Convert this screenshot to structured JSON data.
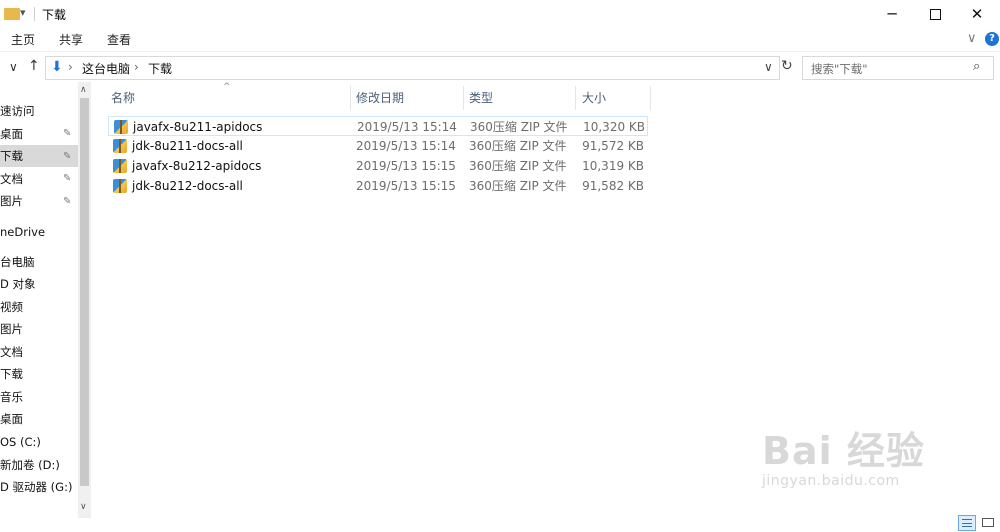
{
  "window": {
    "title": "下载"
  },
  "ribbon": {
    "tabs": [
      "主页",
      "共享",
      "查看"
    ]
  },
  "address": {
    "crumbs": [
      "这台电脑",
      "下载"
    ],
    "separator": "›"
  },
  "search": {
    "placeholder": "搜索\"下载\""
  },
  "nav": {
    "items": [
      {
        "label": "速访问",
        "pinned": false
      },
      {
        "label": "桌面",
        "pinned": true
      },
      {
        "label": "下载",
        "pinned": true,
        "selected": true
      },
      {
        "label": "文档",
        "pinned": true
      },
      {
        "label": "图片",
        "pinned": true
      },
      {
        "label": "neDrive",
        "pinned": false
      },
      {
        "label": "台电脑",
        "pinned": false
      },
      {
        "label": "D 对象",
        "pinned": false
      },
      {
        "label": "视频",
        "pinned": false
      },
      {
        "label": "图片",
        "pinned": false
      },
      {
        "label": "文档",
        "pinned": false
      },
      {
        "label": "下载",
        "pinned": false
      },
      {
        "label": "音乐",
        "pinned": false
      },
      {
        "label": "桌面",
        "pinned": false
      },
      {
        "label": "OS (C:)",
        "pinned": false
      },
      {
        "label": "新加卷 (D:)",
        "pinned": false
      },
      {
        "label": "D 驱动器 (G:)",
        "pinned": false
      }
    ]
  },
  "columns": {
    "name": "名称",
    "date": "修改日期",
    "type": "类型",
    "size": "大小"
  },
  "files": [
    {
      "name": "javafx-8u211-apidocs",
      "date": "2019/5/13 15:14",
      "type": "360压缩 ZIP 文件",
      "size": "10,320 KB",
      "selected": true
    },
    {
      "name": "jdk-8u211-docs-all",
      "date": "2019/5/13 15:14",
      "type": "360压缩 ZIP 文件",
      "size": "91,572 KB"
    },
    {
      "name": "javafx-8u212-apidocs",
      "date": "2019/5/13 15:15",
      "type": "360压缩 ZIP 文件",
      "size": "10,319 KB"
    },
    {
      "name": "jdk-8u212-docs-all",
      "date": "2019/5/13 15:15",
      "type": "360压缩 ZIP 文件",
      "size": "91,582 KB"
    }
  ],
  "watermark": {
    "logo": "Bai 经验",
    "url": "jingyan.baidu.com"
  },
  "colors": {
    "accent": "#0063b1",
    "help": "#1e73d6",
    "header_text": "#4c607a"
  }
}
